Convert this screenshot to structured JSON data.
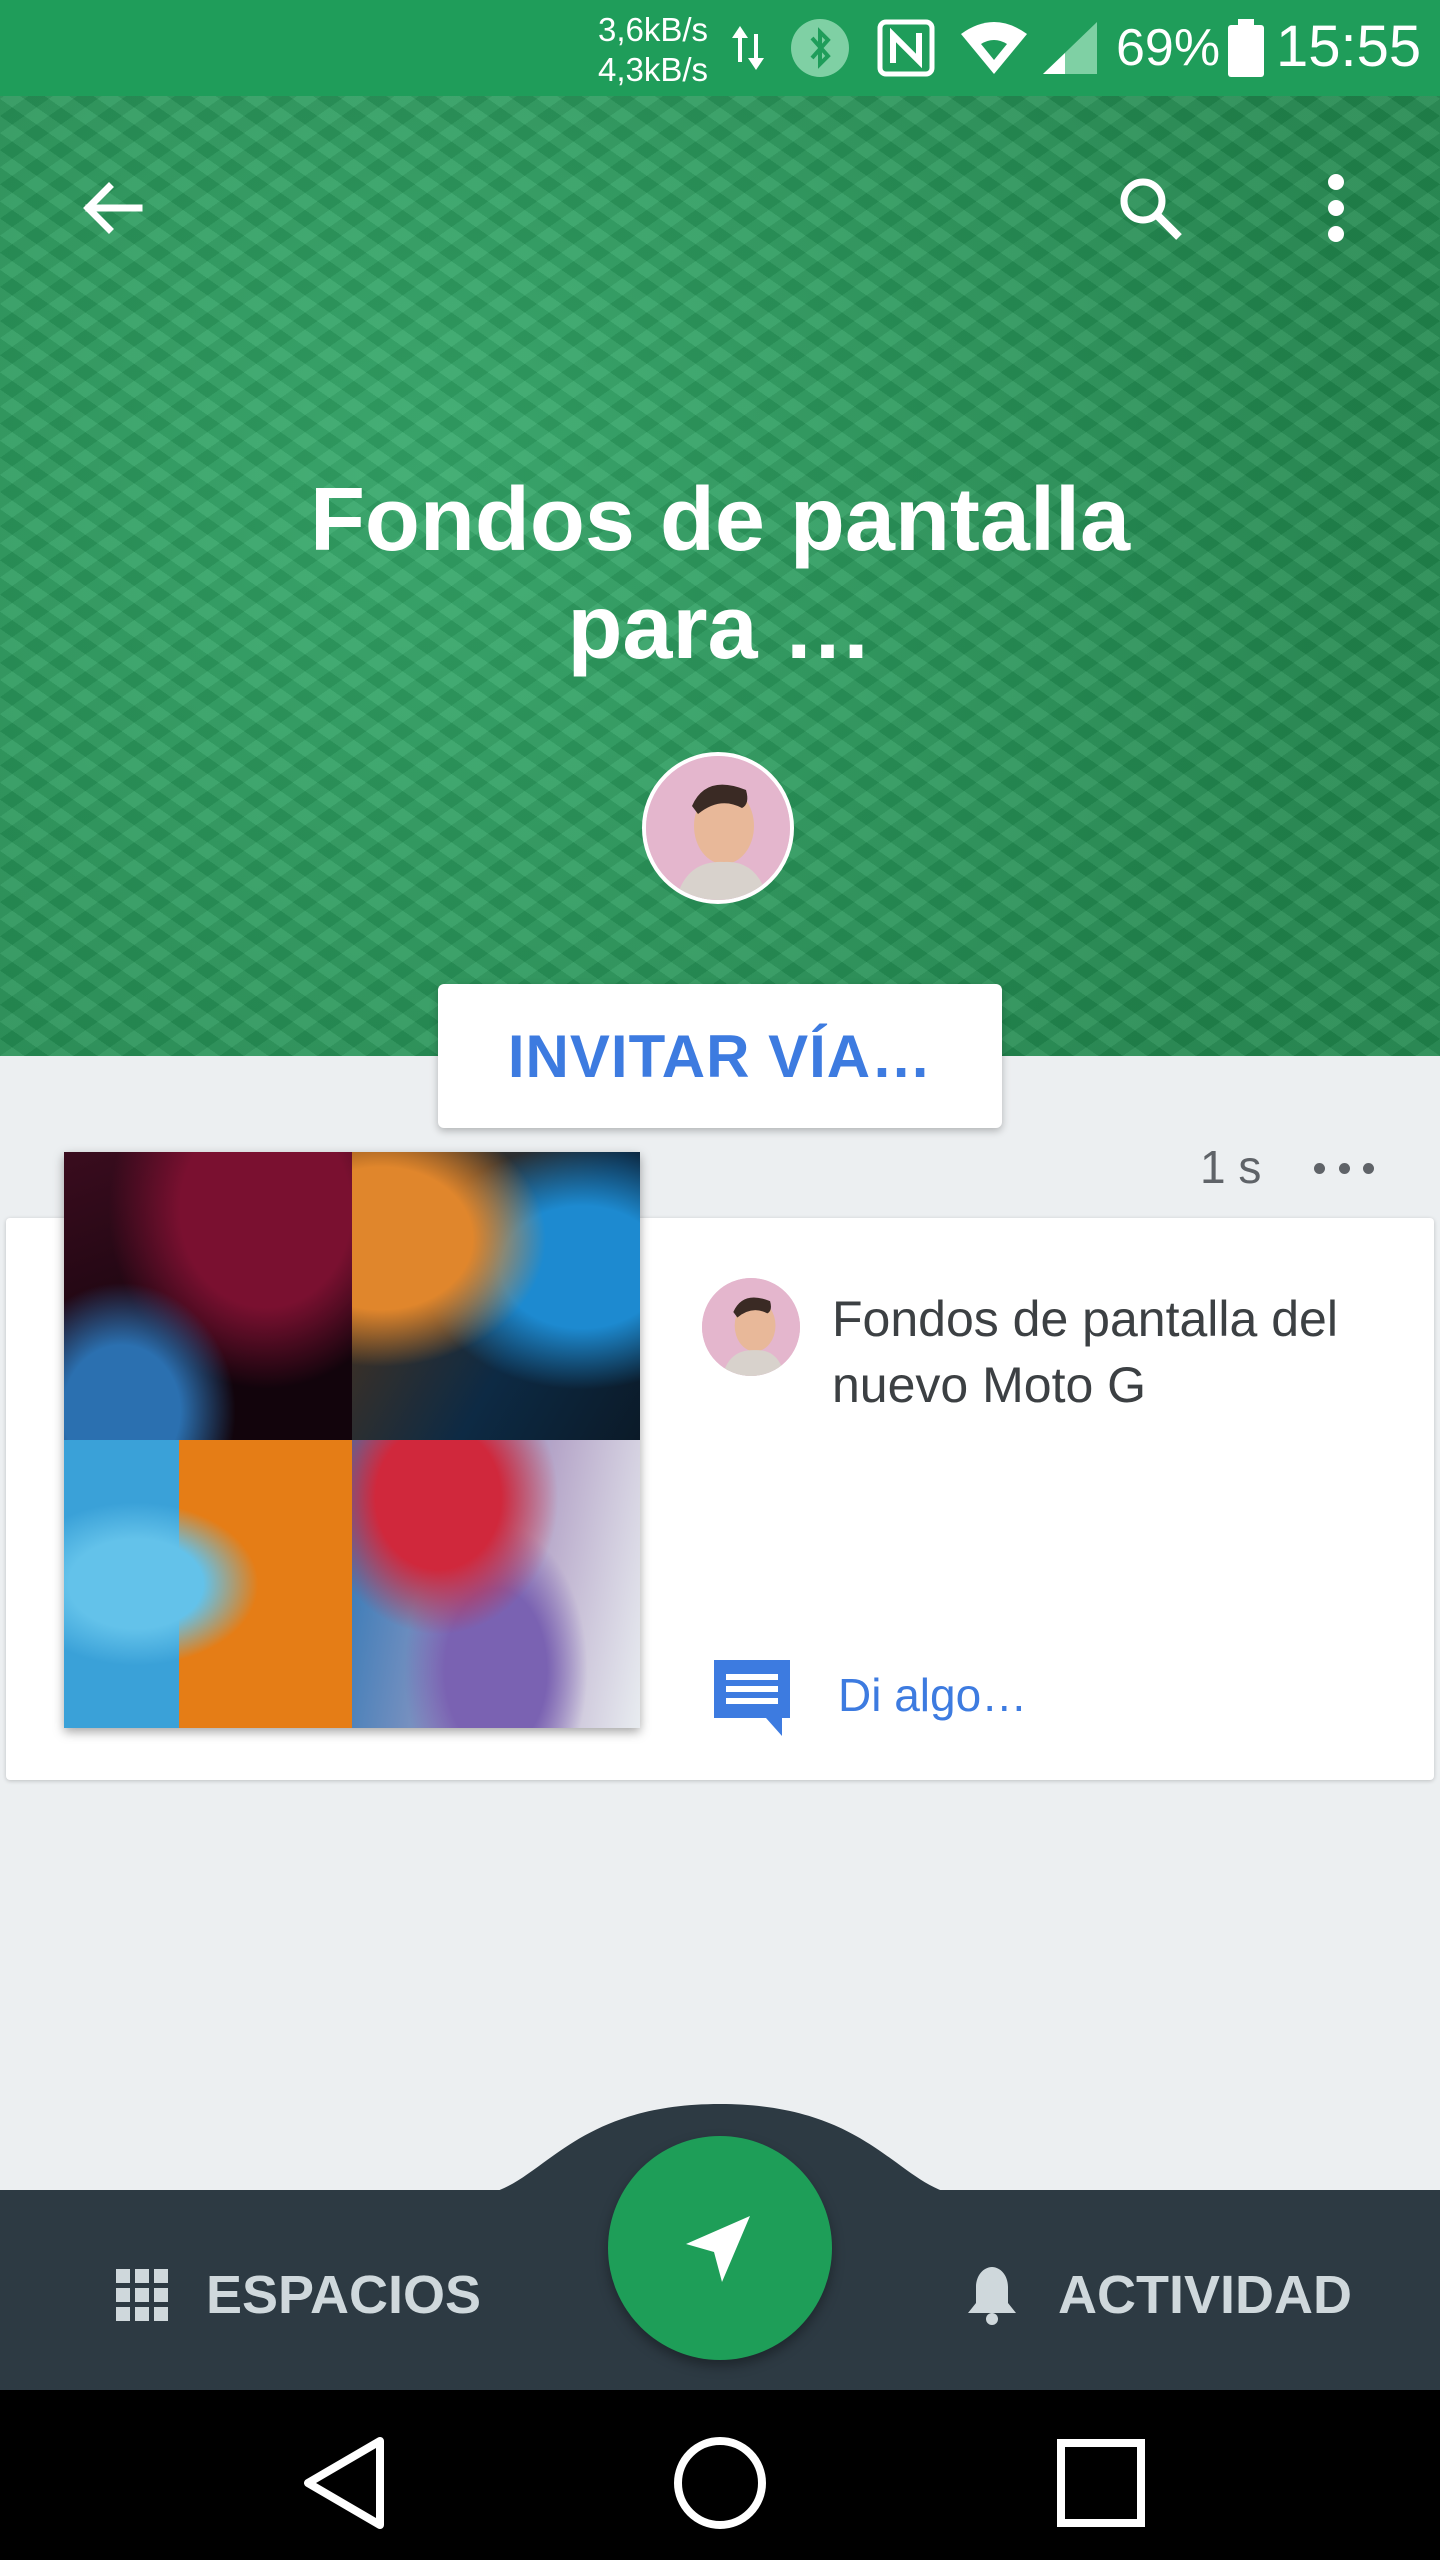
{
  "status_bar": {
    "net_up": "3,6kB/s",
    "net_down": "4,3kB/s",
    "battery": "69%",
    "time": "15:55",
    "icons": [
      "data-arrows-icon",
      "bluetooth-icon",
      "nfc-icon",
      "wifi-icon",
      "signal-icon",
      "battery-icon"
    ]
  },
  "header": {
    "back_icon": "arrow-back-icon",
    "search_icon": "search-icon",
    "menu_icon": "more-vert-icon",
    "title": "Fondos de pantalla para …",
    "invite_label": "INVITAR VÍA…",
    "accent": "#2a9d5f"
  },
  "post": {
    "time": "1 s",
    "title": "Fondos de pantalla del nuevo Moto G",
    "comment_label": "Di algo…"
  },
  "bottom_nav": {
    "spaces_label": "ESPACIOS",
    "activity_label": "ACTIVIDAD",
    "fab_icon": "send-icon",
    "bar_color": "#2d3a43",
    "fab_color": "#1e9e58"
  },
  "system_nav": [
    "back-triangle-icon",
    "home-circle-icon",
    "recents-square-icon"
  ],
  "colors": {
    "link": "#3d7be0",
    "text": "#3c4043"
  }
}
